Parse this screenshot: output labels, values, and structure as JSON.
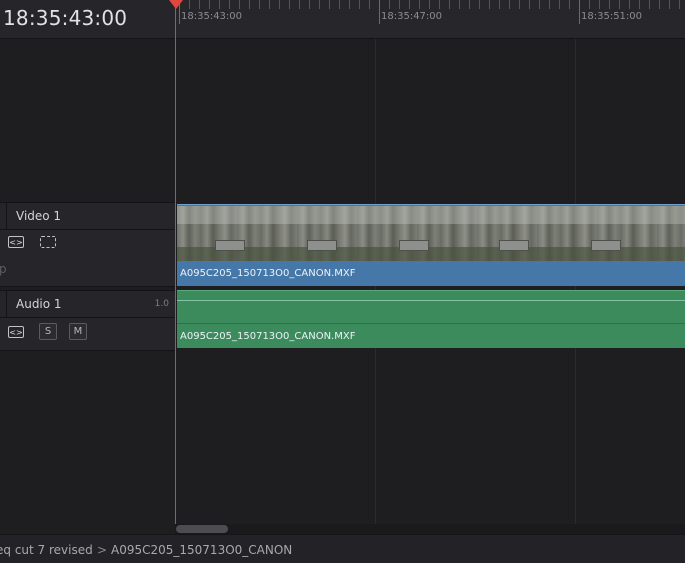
{
  "header": {
    "timecode": "18:35:43:00"
  },
  "ruler": {
    "labels": [
      "18:35:43:00",
      "18:35:47:00",
      "18:35:51:00"
    ]
  },
  "tracks": {
    "video": {
      "name": "Video 1",
      "cut_char": "p"
    },
    "audio": {
      "name": "Audio 1",
      "level": "1.0",
      "solo": "S",
      "mute": "M"
    }
  },
  "clips": {
    "video_clip": {
      "name": "A095C205_150713O0_CANON.MXF"
    },
    "audio_clip": {
      "name": "A095C205_150713O0_CANON.MXF"
    }
  },
  "breadcrumb": {
    "parent": "eq cut 7 revised",
    "separator": ">",
    "current": "A095C205_150713O0_CANON"
  },
  "colors": {
    "video_clip": "#4577a8",
    "audio_clip": "#3b8b5d",
    "playhead": "#d9423b"
  }
}
